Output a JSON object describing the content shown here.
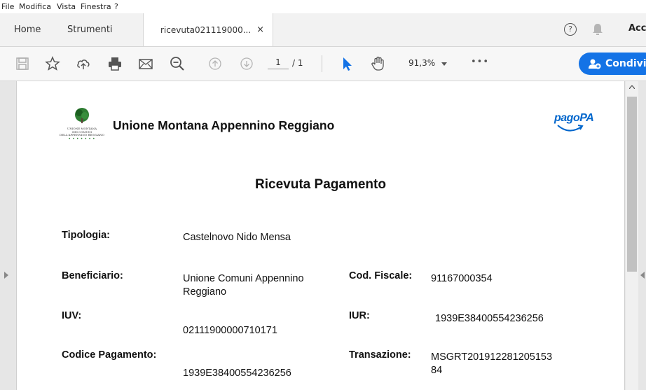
{
  "menu": [
    "File",
    "Modifica",
    "Vista",
    "Finestra",
    "?"
  ],
  "tabs": {
    "home": "Home",
    "tools": "Strumenti",
    "document": "ricevuta021119000...",
    "close": "×",
    "account": "Acc"
  },
  "toolbar": {
    "page_current": "1",
    "page_total": "/ 1",
    "zoom": "91,3%",
    "more": "•••",
    "share_label": "Condivi"
  },
  "document": {
    "org_name": "Unione Montana Appennino Reggiano",
    "logo_text": [
      "UNIONE MONTANA",
      "DEI COMUNI",
      "DELL'APPENNINO REGGIANO"
    ],
    "pagopa": "pagoPA",
    "title": "Ricevuta Pagamento",
    "fields": {
      "tipologia_label": "Tipologia:",
      "tipologia_value": "Castelnovo Nido Mensa",
      "beneficiario_label": "Beneficiario:",
      "beneficiario_value_1": "Unione Comuni Appennino",
      "beneficiario_value_2": "Reggiano",
      "cf_label": "Cod. Fiscale:",
      "cf_value": "91167000354",
      "iuv_label": "IUV:",
      "iuv_value": "02111900000710171",
      "iur_label": "IUR:",
      "iur_value": "1939E38400554236256",
      "codice_label": "Codice Pagamento:",
      "codice_value": "1939E38400554236256",
      "transazione_label": "Transazione:",
      "transazione_value_1": "MSGRT201912281205153",
      "transazione_value_2": "84"
    }
  },
  "colors": {
    "accent": "#1473e6",
    "pagopa": "#0066cc"
  }
}
